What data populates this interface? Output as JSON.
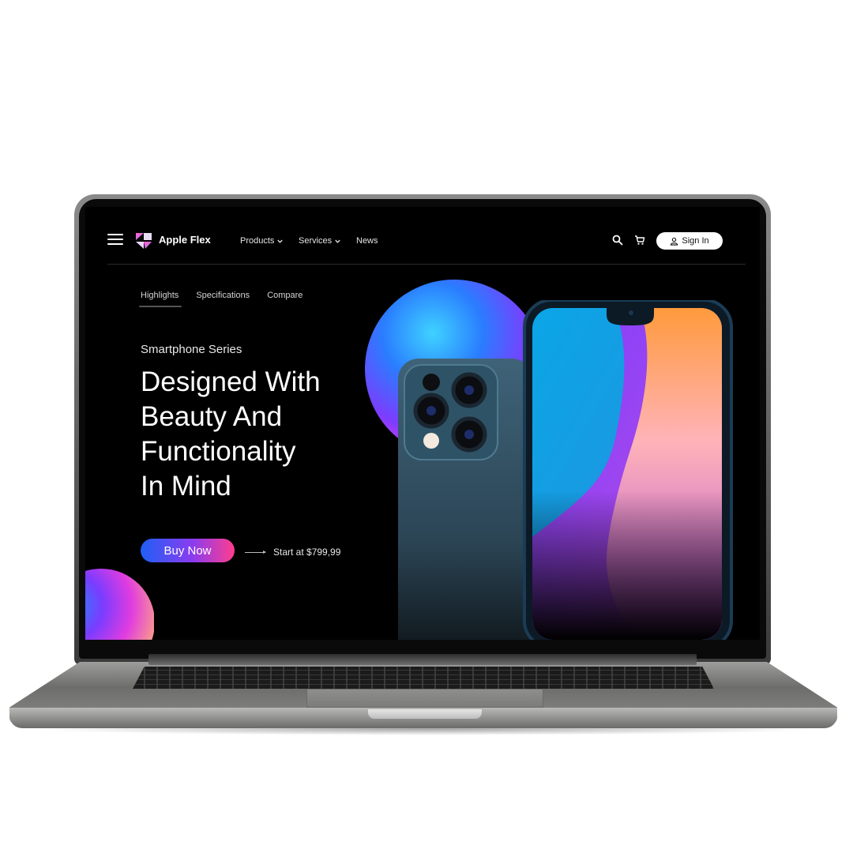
{
  "nav": {
    "brand": "Apple Flex",
    "menu": [
      {
        "label": "Products",
        "has_dropdown": true
      },
      {
        "label": "Services",
        "has_dropdown": true
      },
      {
        "label": "News",
        "has_dropdown": false
      }
    ],
    "icons": [
      "menu-icon",
      "logo-icon",
      "search-icon",
      "cart-icon",
      "user-icon"
    ],
    "signin_label": "Sign In"
  },
  "tabs": {
    "items": [
      "Highlights",
      "Specifications",
      "Compare"
    ],
    "active": "Highlights"
  },
  "hero": {
    "eyebrow": "Smartphone Series",
    "headline_lines": [
      "Designed With",
      "Beauty And",
      "Functionality",
      "In Mind"
    ],
    "cta_label": "Buy Now",
    "price_text": "Start at $799,99"
  },
  "colors": {
    "page_bg": "#000000",
    "cta_gradient": [
      "#1f5ff5",
      "#8a3cf0",
      "#ff3d8d"
    ],
    "accent_orb": [
      "#3fd2ff",
      "#2a7dff",
      "#7d3cff",
      "#d33cf7",
      "#ff5fa8"
    ]
  }
}
